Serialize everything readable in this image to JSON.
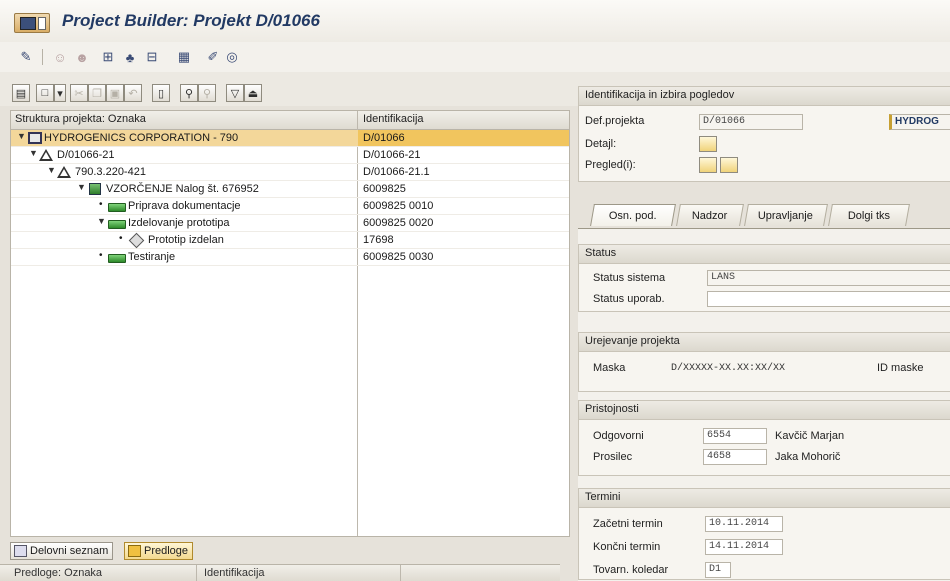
{
  "window": {
    "title": "Project Builder: Projekt D/01066"
  },
  "colors": {
    "title_text": "#223a64",
    "selection": "#f3d79a",
    "selection_cell": "#f1c55e"
  },
  "toolbar1_icons": [
    "pen-icon",
    "people-icon",
    "people2-icon",
    "hierarchy-icon",
    "org-icon",
    "network-icon",
    "grid-icon",
    "edit-icon",
    "circle-icon"
  ],
  "toolbar2_icons": [
    "open-folder-icon",
    "new-doc-icon",
    "cut-icon",
    "copy-icon",
    "paste-icon",
    "undo-icon",
    "delete-icon",
    "find-icon",
    "find-next-icon",
    "filter-icon",
    "sort-icon"
  ],
  "tree": {
    "col_structure": "Struktura projekta: Oznaka",
    "col_ident": "Identifikacija",
    "rows": [
      {
        "label": "HYDROGENICS CORPORATION - 790",
        "ident": "D/01066",
        "icon": "project-icon"
      },
      {
        "label": "D/01066-21",
        "ident": "D/01066-21",
        "icon": "wbs-triangle-icon"
      },
      {
        "label": "790.3.220-421",
        "ident": "D/01066-21.1",
        "icon": "wbs-triangle-icon"
      },
      {
        "label": "VZORČENJE Nalog št. 676952",
        "ident": "6009825",
        "icon": "order-icon"
      },
      {
        "label": "Priprava dokumentacje",
        "ident": "6009825 0010",
        "icon": "activity-icon"
      },
      {
        "label": "Izdelovanje prototipa",
        "ident": "6009825 0020",
        "icon": "activity-icon"
      },
      {
        "label": "Prototip izdelan",
        "ident": "17698",
        "icon": "milestone-icon"
      },
      {
        "label": "Testiranje",
        "ident": "6009825 0030",
        "icon": "activity-icon"
      }
    ]
  },
  "bottom_tabs": {
    "worklist": "Delovni seznam",
    "templates": "Predloge"
  },
  "bottom_list": {
    "col_templates": "Predloge: Oznaka",
    "col_ident": "Identifikacija"
  },
  "detail": {
    "header": "Identifikacija in izbira pogledov",
    "def_label": "Def.projekta",
    "def_value": "D/01066",
    "def_desc": "HYDROG",
    "details_label": "Detajl:",
    "views_label": "Pregled(i):",
    "tabs": [
      "Osn. pod.",
      "Nadzor",
      "Upravljanje",
      "Dolgi tks"
    ],
    "status": {
      "header": "Status",
      "system_label": "Status sistema",
      "system_value": "LANS",
      "user_label": "Status uporab.",
      "user_value": ""
    },
    "editing": {
      "header": "Urejevanje projekta",
      "mask_label": "Maska",
      "mask_value": "D/XXXXX-XX.XX:XX/XX",
      "mask_id_label": "ID maske"
    },
    "responsibilities": {
      "header": "Pristojnosti",
      "responsible_label": "Odgovorni",
      "responsible_code": "6554",
      "responsible_name": "Kavčič Marjan",
      "applicant_label": "Prosilec",
      "applicant_code": "4658",
      "applicant_name": "Jaka Mohorič"
    },
    "dates": {
      "header": "Termini",
      "start_label": "Začetni termin",
      "start_value": "10.11.2014",
      "end_label": "Končni termin",
      "end_value": "14.11.2014",
      "calendar_label": "Tovarn. koledar",
      "calendar_value": "D1"
    }
  }
}
